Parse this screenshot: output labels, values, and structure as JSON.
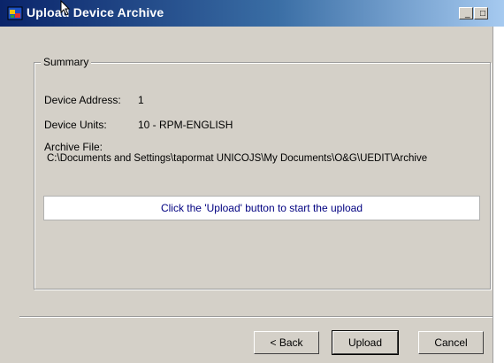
{
  "window": {
    "title": "Upload Device Archive",
    "controls": {
      "minimize": "_",
      "maximize": "□"
    }
  },
  "summary": {
    "group_label": "Summary",
    "device_address_label": "Device Address:",
    "device_address_value": "1",
    "device_units_label": "Device Units:",
    "device_units_value": "10 - RPM-ENGLISH",
    "archive_file_label": "Archive File:",
    "archive_file_path": "C:\\Documents and Settings\\tapormat UNICOJS\\My Documents\\O&G\\UEDIT\\Archive"
  },
  "notice": "Click the 'Upload' button to start the upload",
  "buttons": {
    "back": "< Back",
    "upload": "Upload",
    "cancel": "Cancel"
  },
  "icons": {
    "app": "app-window-icon",
    "cursor": "mouse-pointer-icon"
  }
}
